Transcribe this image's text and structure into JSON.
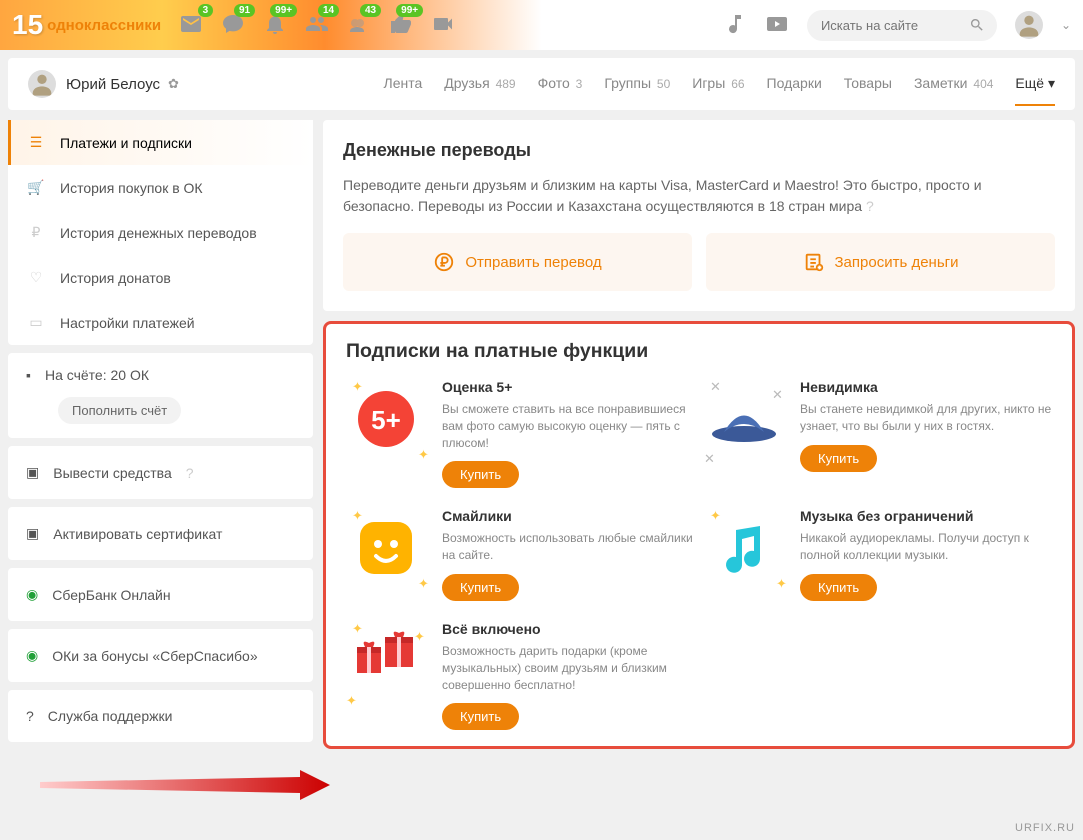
{
  "brand": {
    "num": "15",
    "name": "одноклассники"
  },
  "topnav_badges": [
    "3",
    "91",
    "99+",
    "14",
    "43",
    "99+"
  ],
  "search": {
    "placeholder": "Искать на сайте"
  },
  "user": {
    "name": "Юрий Белоус"
  },
  "tabs": [
    {
      "label": "Лента",
      "count": ""
    },
    {
      "label": "Друзья",
      "count": "489"
    },
    {
      "label": "Фото",
      "count": "3"
    },
    {
      "label": "Группы",
      "count": "50"
    },
    {
      "label": "Игры",
      "count": "66"
    },
    {
      "label": "Подарки",
      "count": ""
    },
    {
      "label": "Товары",
      "count": ""
    },
    {
      "label": "Заметки",
      "count": "404"
    }
  ],
  "more_label": "Ещё",
  "sidemenu": [
    "Платежи и подписки",
    "История покупок в ОК",
    "История денежных переводов",
    "История донатов",
    "Настройки платежей"
  ],
  "wallet": {
    "balance": "На счёте: 20 ОК",
    "topup": "Пополнить счёт"
  },
  "sidelinks": [
    "Вывести средства",
    "Активировать сертификат",
    "СберБанк Онлайн",
    "ОКи за бонусы «СберСпасибо»",
    "Служба поддержки"
  ],
  "transfers": {
    "title": "Денежные переводы",
    "desc": "Переводите деньги друзьям и близким на карты Visa, MasterCard и Maestro! Это быстро, просто и безопасно. Переводы из России и Казахстана осуществляются в 18 стран мира",
    "send": "Отправить перевод",
    "request": "Запросить деньги"
  },
  "subs": {
    "title": "Подписки на платные функции",
    "buy": "Купить",
    "items": [
      {
        "title": "Оценка 5+",
        "desc": "Вы сможете ставить на все понравившиеся вам фото самую высокую оценку — пять с плюсом!"
      },
      {
        "title": "Невидимка",
        "desc": "Вы станете невидимкой для других, никто не узнает, что вы были у них в гостях."
      },
      {
        "title": "Смайлики",
        "desc": "Возможность использовать любые смайлики на сайте."
      },
      {
        "title": "Музыка без ограничений",
        "desc": "Никакой аудиорекламы. Получи доступ к полной коллекции музыки."
      },
      {
        "title": "Всё включено",
        "desc": "Возможность дарить подарки (кроме музыкальных) своим друзьям и близким совершенно бесплатно!"
      }
    ]
  },
  "watermark": "URFIX.RU"
}
